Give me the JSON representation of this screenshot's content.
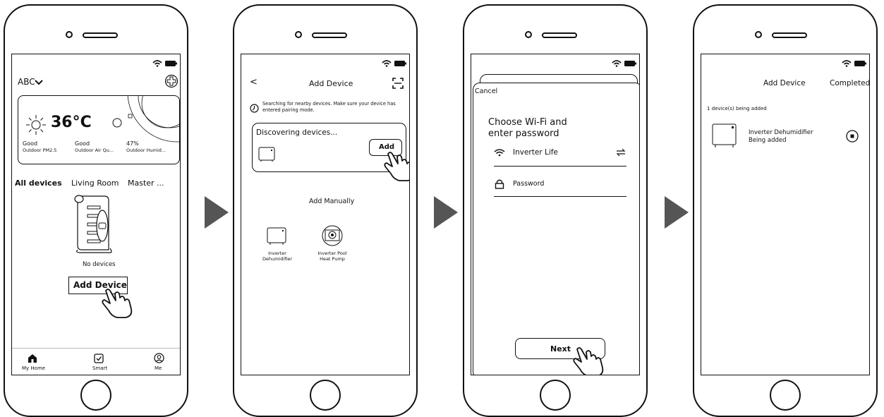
{
  "screen1": {
    "account": "ABC",
    "temperature": "36°C",
    "stats": [
      {
        "value": "Good",
        "label": "Outdoor PM2.5"
      },
      {
        "value": "Good",
        "label": "Outdoor Air Qu..."
      },
      {
        "value": "47%",
        "label": "Outdoor Humid..."
      }
    ],
    "rooms": [
      "All devices",
      "Living Room",
      "Master ..."
    ],
    "empty_text": "No devices",
    "add_button": "Add  Device",
    "nav": [
      "My Home",
      "Smart",
      "Me"
    ]
  },
  "screen2": {
    "back": "<",
    "title": "Add  Device",
    "hint": "Searching for nearby devices. Make sure your device has entered pairing mode.",
    "discovering": "Discovering devices...",
    "add_button": "Add",
    "manual_title": "Add Manually",
    "devices": [
      "Inverter Dehumidifier",
      "Inverter Pool Heat Pump"
    ]
  },
  "screen3": {
    "cancel": "Cancel",
    "heading_line1": "Choose Wi-Fi and",
    "heading_line2": "enter password",
    "wifi_name": "Inverter Life",
    "password_placeholder": "Password",
    "next_button": "Next"
  },
  "screen4": {
    "title": "Add Device",
    "completed": "Completed",
    "count_text": "1 device(s) being added",
    "device_name": "Inverter Dehumidifier",
    "device_status": "Being added"
  },
  "icons": [
    "wifi-icon",
    "battery-icon",
    "plus-circle-icon",
    "sun-icon",
    "scroll-icon",
    "hand-pointer-icon",
    "home-icon",
    "check-square-icon",
    "user-icon",
    "scan-icon",
    "clock-icon",
    "swap-icon",
    "lock-icon",
    "dehumidifier-icon",
    "heat-pump-icon",
    "stop-icon",
    "play-arrow-icon"
  ]
}
